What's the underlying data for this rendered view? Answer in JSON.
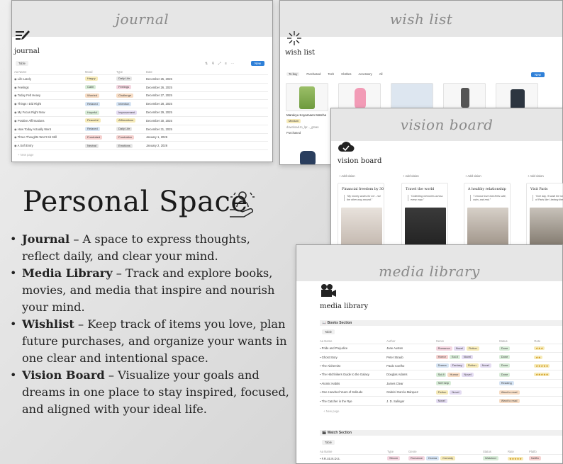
{
  "journal": {
    "cover": "journal",
    "title": "journal",
    "view_tab": "Table",
    "new_button": "New",
    "toolbar_icons": "⇅ ⚲ ⤢ ≡ ⋯",
    "columns": [
      "Aa Name",
      "Mood",
      "Type",
      "Date"
    ],
    "rows": [
      {
        "name": "Life Lately",
        "mood": "Happy",
        "type": "Daily Life",
        "date": "December 25, 2025"
      },
      {
        "name": "Feelings",
        "mood": "Calm",
        "type": "Feelings",
        "date": "December 26, 2025"
      },
      {
        "name": "Today Felt Heavy",
        "mood": "Worried",
        "type": "Challenge",
        "date": "December 27, 2025"
      },
      {
        "name": "Things I Did Right",
        "mood": "Relaxed",
        "type": "Intention",
        "date": "December 28, 2025"
      },
      {
        "name": "My Focus Right Now",
        "mood": "Hopeful",
        "type": "Improvement",
        "date": "December 29, 2025"
      },
      {
        "name": "Positive Affirmations",
        "mood": "Peaceful",
        "type": "Affirmations",
        "date": "December 30, 2025"
      },
      {
        "name": "How Today Actually Went",
        "mood": "Relaxed",
        "type": "Daily Life",
        "date": "December 31, 2025"
      },
      {
        "name": "Three Thoughts Won't Sit Still",
        "mood": "Frustrated",
        "type": "Frustration",
        "date": "January 1, 2026"
      },
      {
        "name": "A Soft Entry",
        "mood": "Neutral",
        "type": "Emotions",
        "date": "January 2, 2026"
      }
    ],
    "new_page": "+ New page"
  },
  "wishlist": {
    "cover": "wish list",
    "title": "wish list",
    "tabs": [
      "To buy",
      "Purchased",
      "Tech",
      "Clothes",
      "Accessory",
      "All"
    ],
    "new_button": "New",
    "item": {
      "name": "Marukyu Koyamaen Matcha",
      "tag": "Medium",
      "link": "download.to_lpr..._gtoan",
      "status": "Purchased"
    }
  },
  "vision": {
    "cover": "vision board",
    "title": "vision board",
    "add_label": "+ Add vision",
    "cards": [
      {
        "title": "Financial freedom by 30",
        "quote": "\"My money works for me - not the other way around.\""
      },
      {
        "title": "Travel the world",
        "quote": "\"Collecting memories across every map.\""
      },
      {
        "title": "A healthy relationship",
        "quote": "\"I choose love that feels safe, calm, and real.\""
      },
      {
        "title": "Visit Paris",
        "quote": "\"One day, I'll walk the streets of Paris like I belong there.\""
      }
    ]
  },
  "media": {
    "cover": "media library",
    "title": "media library",
    "books_section": "Books Section",
    "view_tab": "Table",
    "book_columns": [
      "Aa Name",
      "Author",
      "Genre",
      "Status",
      "Rate"
    ],
    "books": [
      {
        "name": "Pride and Prejudice",
        "author": "Jane Austen",
        "genre": [
          "Romance",
          "Novel",
          "Fiction"
        ],
        "status": "Done",
        "rate": "★★★"
      },
      {
        "name": "Ghost Story",
        "author": "Peter Straub",
        "genre": [
          "Horror",
          "Sci-fi",
          "Novel"
        ],
        "status": "Done",
        "rate": "★★"
      },
      {
        "name": "The Alchemist",
        "author": "Paulo Coelho",
        "genre": [
          "Drama",
          "Fantasy",
          "Fiction",
          "Novel"
        ],
        "status": "Done",
        "rate": "★★★★★"
      },
      {
        "name": "The Hitchhikers Guide to the Galaxy",
        "author": "Douglas Adams",
        "genre": [
          "Sci-fi",
          "Humor",
          "Novel"
        ],
        "status": "Done",
        "rate": "★★★★★"
      },
      {
        "name": "Atomic Habits",
        "author": "James Clear",
        "genre": [
          "Self help"
        ],
        "status": "Reading",
        "rate": ""
      },
      {
        "name": "One Hundred Years of Solitude",
        "author": "Gabriel García Márquez",
        "genre": [
          "Fiction",
          "Novel"
        ],
        "status": "Want to read",
        "rate": ""
      },
      {
        "name": "The Catcher in the Rye",
        "author": "J. D. Salinger",
        "genre": [
          "Novel"
        ],
        "status": "Want to read",
        "rate": ""
      }
    ],
    "new_page": "+ New page",
    "watch_section": "Watch Section",
    "watch_columns": [
      "Aa Name",
      "Type",
      "Genre",
      "Status",
      "Rate",
      "Platfo"
    ],
    "watch_row": {
      "name": "F.R.I.E.N.D.S.",
      "type": "Sitcom",
      "genre": [
        "Romance",
        "Drama",
        "Comedy"
      ],
      "status": "Watched",
      "rate": "★★★★★",
      "platform": "Netflix"
    }
  },
  "main": {
    "heading": "Personal Space",
    "bullets": [
      {
        "term": "Journal",
        "text": " – A space to express thoughts, reflect daily, and clear your mind."
      },
      {
        "term": "Media Library",
        "text": " – Track and explore books, movies, and media that inspire and nourish your mind."
      },
      {
        "term": "Wishlist",
        "text": " – Keep track of items you love, plan future purchases, and organize your wants in one clear and intentional space."
      },
      {
        "term": "Vision Board",
        "text": " – Visualize your goals and dreams in one place to stay inspired, focused, and aligned with your ideal life."
      }
    ]
  },
  "colors": {
    "accent": "#2f80d8",
    "cover": "#e6e6e6",
    "tag_yellow": "#f6eab8",
    "tag_green": "#d8ecd8",
    "tag_pink": "#f4d6e0",
    "tag_blue": "#d6e4f4",
    "tag_orange": "#f7dcc4",
    "tag_gray": "#e6e6e6",
    "tag_purple": "#e4dcf2",
    "tag_red": "#f6d2d0"
  }
}
